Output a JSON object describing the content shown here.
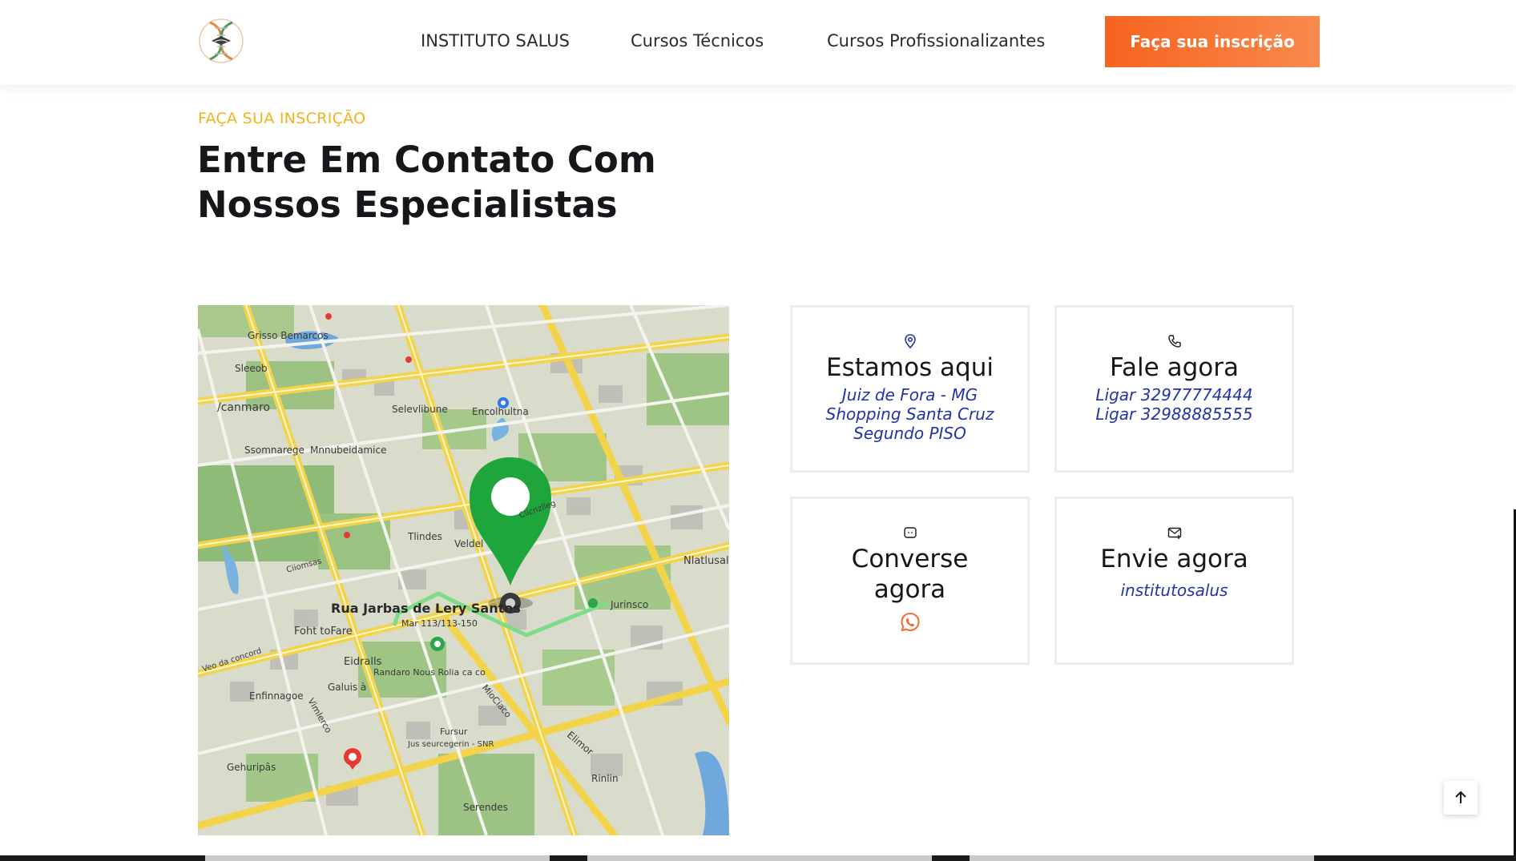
{
  "header": {
    "logo_icon": "dna-logo-icon",
    "nav": [
      {
        "label": "INSTITUTO SALUS"
      },
      {
        "label": "Cursos Técnicos"
      },
      {
        "label": "Cursos Profissionalizantes"
      }
    ],
    "cta_label": "Faça sua inscrição",
    "accent_color": "#f7631f"
  },
  "intro": {
    "eyebrow": "FAÇA SUA INSCRIÇÃO",
    "title_line1": "Entre Em Contato Com",
    "title_line2": "Nossos Especialistas",
    "eyebrow_color": "#f2b21b"
  },
  "map": {
    "street_label": "Rua Jarbas de Lery Santos",
    "street_sub": "Mar 113/113-150",
    "labels": [
      "Grisso Bemarcos",
      "Sleeob",
      "/canmaro",
      "Ssomnarege",
      "Mnnubeidamice",
      "Selevlibune",
      "Encolhultna",
      "Tlindes",
      "Veldel",
      "Foht toFare",
      "Eidralls",
      "Randaro Nous Rolia ca co",
      "Galuis à",
      "Enfinnagoe",
      "Gehuripâs",
      "Jurinsco",
      "Nlatlusal",
      "Rinlin",
      "Serendes",
      "Fursur",
      "Jus seurcegerin - SNR",
      "Vimlerco",
      "Elimor",
      "MioCiaco",
      "Clicnzlleg",
      "Ciiomsas",
      "Veo da concord"
    ],
    "pin_icon": "location-pin-icon"
  },
  "cards": [
    {
      "icon": "map-marker-icon",
      "title": "Estamos aqui",
      "lines": [
        "Juiz de Fora - MG",
        "Shopping Santa Cruz",
        "Segundo PISO"
      ]
    },
    {
      "icon": "phone-icon",
      "title": "Fale agora",
      "lines": [
        "Ligar 32977774444",
        "Ligar 32988885555"
      ]
    },
    {
      "icon": "chat-icon",
      "title": "Converse agora",
      "action_icon": "whatsapp-icon"
    },
    {
      "icon": "mail-icon",
      "title": "Envie agora",
      "lines": [
        "institutosalus"
      ]
    }
  ],
  "card_link_color": "#2233aa",
  "back_to_top_icon": "arrow-up-icon"
}
